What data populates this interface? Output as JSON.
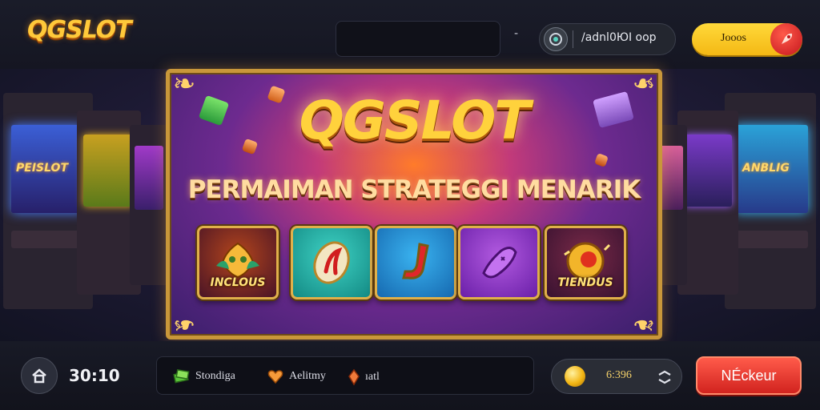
{
  "header": {
    "logo_text": "QGSLOT",
    "dash_text": "-",
    "account_label": "/adnl0ЮI oop",
    "join_label": "Jooos"
  },
  "banner": {
    "title": "QGSLOT",
    "subtitle": "PERMAIMAN STRATEGGI MENARIK",
    "tiles": [
      {
        "caption": "INCLOUS",
        "icon": "golden-mask-icon",
        "color": "#6a1f2a"
      },
      {
        "caption": "",
        "icon": "red-swirl-icon",
        "color": "#1aa39a"
      },
      {
        "caption": "",
        "icon": "red-hook-icon",
        "color": "#1b7ec6"
      },
      {
        "caption": "",
        "icon": "purple-boot-icon",
        "color": "#8a2bc2"
      },
      {
        "caption": "TIENDUS",
        "icon": "golden-orb-icon",
        "color": "#4a1c3e"
      }
    ]
  },
  "background": {
    "left_cabinet_text": "PEISLOT",
    "right_cabinet_text": "ANBLIG"
  },
  "footer": {
    "timer": "30:10",
    "info_items": [
      {
        "label": "Stondiga",
        "icon": "green-cash-icon"
      },
      {
        "label": "Aelitmy",
        "icon": "orange-heart-icon"
      },
      {
        "label": "ıatl",
        "icon": "orange-gem-icon"
      }
    ],
    "balance": "6:396",
    "action_label": "NÉckeur"
  },
  "colors": {
    "accent_gold": "#ffd23c",
    "action_red": "#e23a2c",
    "join_yellow": "#fbc92a"
  }
}
